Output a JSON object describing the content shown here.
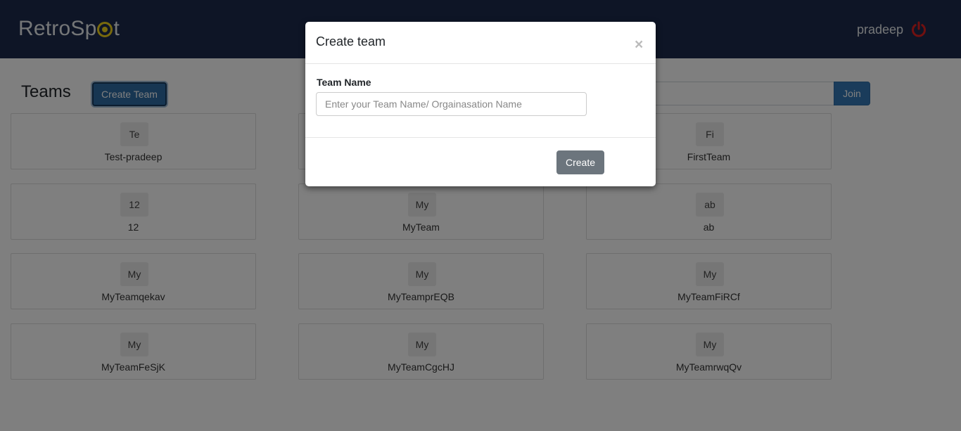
{
  "header": {
    "logo_prefix": "RetroSp",
    "logo_suffix": "t",
    "user_name": "pradeep",
    "brand_accent": "#f1d21a",
    "power_color": "#e02020"
  },
  "main": {
    "title": "Teams",
    "create_team_label": "Create Team",
    "join_label": "Join",
    "cards": [
      {
        "initials": "Te",
        "name": "Test-pradeep"
      },
      {
        "initials": "",
        "name": ""
      },
      {
        "initials": "Fi",
        "name": "FirstTeam"
      },
      {
        "initials": "12",
        "name": "12"
      },
      {
        "initials": "My",
        "name": "MyTeam"
      },
      {
        "initials": "ab",
        "name": "ab"
      },
      {
        "initials": "My",
        "name": "MyTeamqekav"
      },
      {
        "initials": "My",
        "name": "MyTeamprEQB"
      },
      {
        "initials": "My",
        "name": "MyTeamFiRCf"
      },
      {
        "initials": "My",
        "name": "MyTeamFeSjK"
      },
      {
        "initials": "My",
        "name": "MyTeamCgcHJ"
      },
      {
        "initials": "My",
        "name": "MyTeamrwqQv"
      }
    ]
  },
  "modal": {
    "title": "Create team",
    "close_symbol": "×",
    "field_label": "Team Name",
    "input_placeholder": "Enter your Team Name/ Orgainasation Name",
    "input_value": "",
    "create_label": "Create"
  }
}
